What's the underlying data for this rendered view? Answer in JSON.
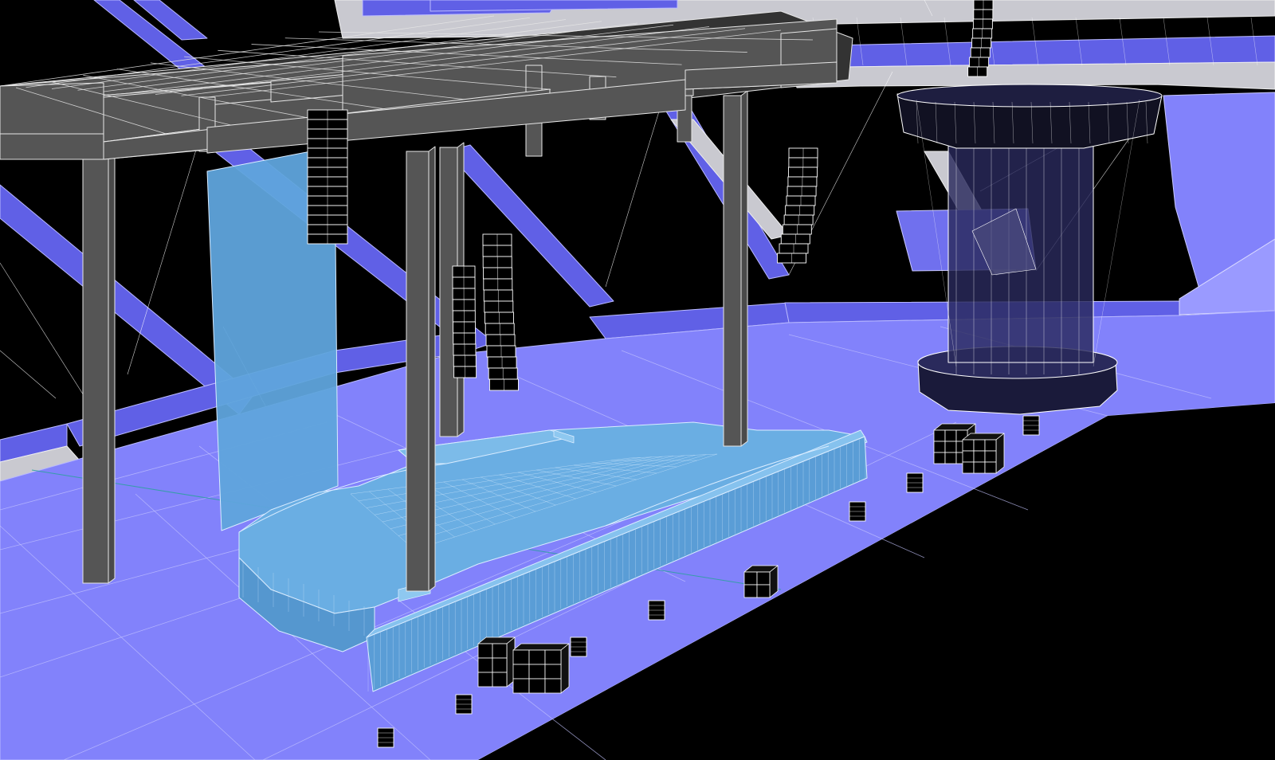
{
  "viewport": {
    "view": "3d-perspective",
    "render_style": "wireframe-shaded"
  },
  "colors": {
    "background": "#000000",
    "floor": "#8282fb",
    "floor_edge": "#5555dd",
    "walkway": "#c9c9d0",
    "wall_band": "#6060e6",
    "truss": "#555555",
    "truss_edge": "#e6e6e6",
    "stage": "#5fa4dc",
    "stage_edge": "#d9ecff",
    "speaker": "#000000",
    "speaker_edge": "#ffffff",
    "tower_glass": "#2a2a5c",
    "axis_line": "#2fa0a0"
  },
  "scene_objects": [
    {
      "id": "roof-truss-grid",
      "icon": "truss-icon"
    },
    {
      "id": "truss-leg-front-left",
      "icon": "column-icon"
    },
    {
      "id": "truss-leg-front-center",
      "icon": "column-icon"
    },
    {
      "id": "truss-leg-back-center",
      "icon": "column-icon"
    },
    {
      "id": "truss-leg-back-right",
      "icon": "column-icon"
    },
    {
      "id": "video-screen-panel",
      "icon": "screen-icon"
    },
    {
      "id": "main-stage-platform",
      "icon": "stage-icon"
    },
    {
      "id": "thrust-runway",
      "icon": "stage-icon"
    },
    {
      "id": "line-array-left-main",
      "icon": "speaker-array-icon"
    },
    {
      "id": "line-array-left-side",
      "icon": "speaker-array-icon"
    },
    {
      "id": "line-array-center",
      "icon": "speaker-array-icon"
    },
    {
      "id": "line-array-right-side",
      "icon": "speaker-array-icon"
    },
    {
      "id": "line-array-tower-hang",
      "icon": "speaker-array-icon"
    },
    {
      "id": "delay-tower",
      "icon": "tower-icon"
    },
    {
      "id": "sub-stack-front-left",
      "icon": "subwoofer-icon"
    },
    {
      "id": "sub-stack-right",
      "icon": "subwoofer-icon"
    },
    {
      "id": "front-fill-row",
      "icon": "speaker-icon"
    }
  ]
}
